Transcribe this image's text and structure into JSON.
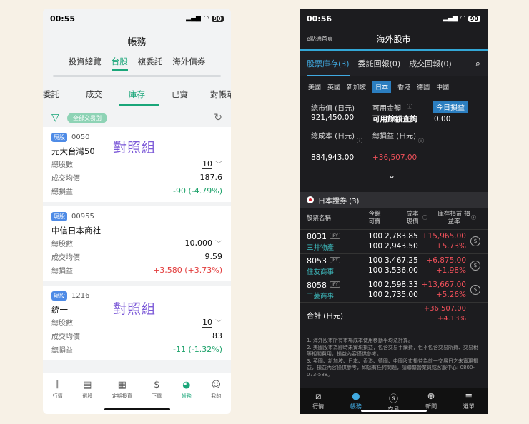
{
  "left": {
    "status": {
      "time": "00:55",
      "battery": "90"
    },
    "title": "帳務",
    "tabs": [
      "投資總覽",
      "台股",
      "複委託",
      "海外債券"
    ],
    "subtabs": [
      "委託",
      "成交",
      "庫存",
      "已實",
      "對帳單"
    ],
    "filter_chip": "全部交易別",
    "overlay_text": "對照組",
    "cards": [
      {
        "badge": "現股",
        "code": "0050",
        "name": "元大台灣50",
        "shares_label": "總股數",
        "shares": "10",
        "avg_label": "成交均價",
        "avg": "187.6",
        "pl_label": "總損益",
        "pl": "-90 (-4.79%)"
      },
      {
        "badge": "現股",
        "code": "00955",
        "name": "中信日本商社",
        "shares_label": "總股數",
        "shares": "10,000",
        "avg_label": "成交均價",
        "avg": "9.59",
        "pl_label": "總損益",
        "pl": "+3,580 (+3.73%)"
      },
      {
        "badge": "現股",
        "code": "1216",
        "name": "統一",
        "shares_label": "總股數",
        "shares": "10",
        "avg_label": "成交均價",
        "avg": "83",
        "pl_label": "總損益",
        "pl": "-11 (-1.32%)"
      }
    ],
    "nav": [
      "行情",
      "選股",
      "定期投資",
      "下單",
      "帳務",
      "我的"
    ]
  },
  "right": {
    "status": {
      "time": "00:56",
      "battery": "90"
    },
    "back_label": "e點通首頁",
    "title": "海外股市",
    "tabs": [
      "股票庫存(3)",
      "委託回報(0)",
      "成交回報(0)"
    ],
    "markets": [
      "美國",
      "英國",
      "新加坡",
      "日本",
      "香港",
      "德國",
      "中國"
    ],
    "summary": {
      "market_value_label": "總市值 (日元)",
      "market_value": "921,450.00",
      "available_label": "可用金額",
      "available_value": "可用餘額查詢",
      "today_pl_label": "今日損益",
      "today_pl": "0.00",
      "total_cost_label": "總成本 (日元)",
      "total_cost": "884,943.00",
      "total_pl_label": "總損益 (日元)",
      "total_pl": "+36,507.00"
    },
    "section": "日本證券 (3)",
    "table_headers": {
      "name": "股票名稱",
      "qty": "今餘 可賣",
      "cost": "成本 現價",
      "pl": "庫存損益 損益率"
    },
    "rows": [
      {
        "code": "8031",
        "currency": "JPY",
        "name": "三井物產",
        "qty1": "100",
        "qty2": "100",
        "cost": "2,783.85",
        "price": "2,943.50",
        "pl": "+15,965.00",
        "pct": "+5.73%"
      },
      {
        "code": "8053",
        "currency": "JPY",
        "name": "住友商事",
        "qty1": "100",
        "qty2": "100",
        "cost": "3,467.25",
        "price": "3,536.00",
        "pl": "+6,875.00",
        "pct": "+1.98%"
      },
      {
        "code": "8058",
        "currency": "JPY",
        "name": "三菱商事",
        "qty1": "100",
        "qty2": "100",
        "cost": "2,598.33",
        "price": "2,735.00",
        "pl": "+13,667.00",
        "pct": "+5.26%"
      }
    ],
    "total_label": "合計 (日元)",
    "total_pl": "+36,507.00",
    "total_pct": "+4.13%",
    "notes": [
      "1. 海外股市所有市場成本使用移動平均法計算。",
      "2. 美國股市為即時未實現損益，包含交易手續費，但不包含交易所費、交易稅等相關費用，損益內容僅供參考。",
      "3. 英國、新加坡、日本、香港、德國、中國股市損益為前一交易日之未實現損益，損益內容僅供參考，如您有任何問題，請聯繫營業員或客服中心: 0800-073-588。"
    ],
    "nav": [
      "行情",
      "帳務",
      "交易",
      "新聞",
      "選單"
    ]
  },
  "colors": {
    "green_accent": "#1aa679",
    "blue_accent": "#40a9e0",
    "profit_red": "#e23b3b",
    "loss_green": "#20a36c"
  }
}
